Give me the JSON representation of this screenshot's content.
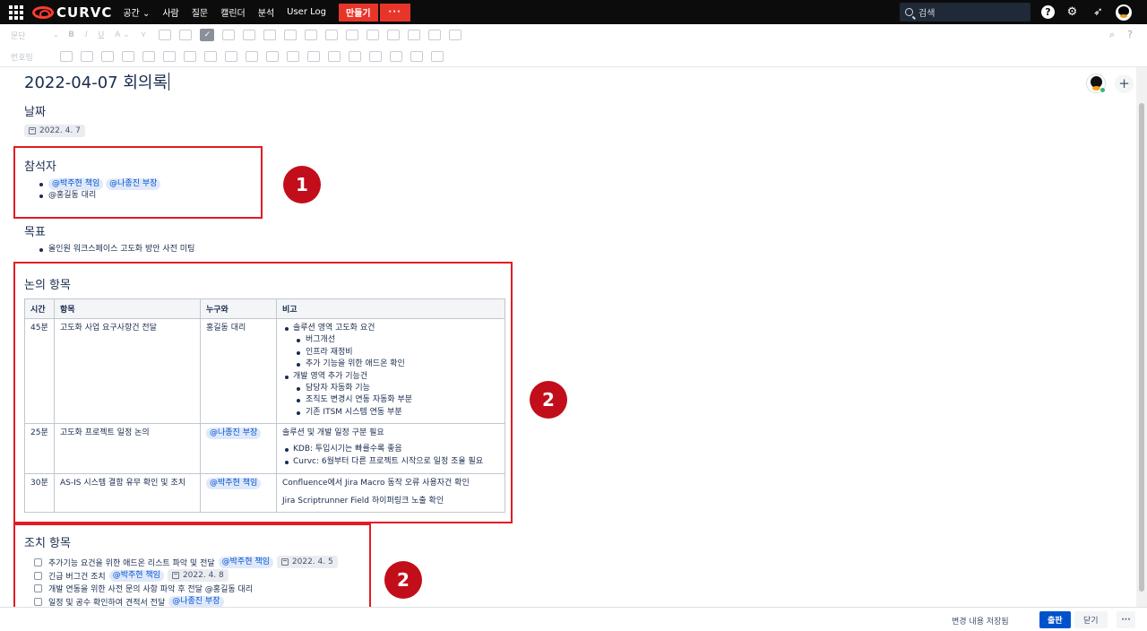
{
  "topbar": {
    "logo": "CURVC",
    "nav": [
      "공간 ⌄",
      "사람",
      "질문",
      "캘린더",
      "분석",
      "User Log"
    ],
    "create_label": "만들기",
    "more_label": "···",
    "search_placeholder": "검색"
  },
  "toolbar": {
    "style_select": "문단",
    "row2_label": "번호링"
  },
  "page": {
    "title": "2022-04-07 회의록",
    "date_heading": "날짜",
    "date_value": "2022. 4. 7",
    "attendees_heading": "참석자",
    "attendees": {
      "mention1": "@박주현 책임",
      "mention2": "@나종진 부장",
      "plain": "@홍길동 대리"
    },
    "goal_heading": "목표",
    "goals": [
      "올인원 워크스페이스 고도화 방안 사전 미팅"
    ],
    "discussion_heading": "논의 항목",
    "table": {
      "headers": [
        "시간",
        "항목",
        "누구와",
        "비고"
      ],
      "rows": [
        {
          "time": "45분",
          "item": "고도화 사업 요구사항건 전달",
          "who": "홍길동 대리"
        },
        {
          "time": "25분",
          "item": "고도화 프로젝트 일정 논의",
          "who": "@나종진 부장"
        },
        {
          "time": "30분",
          "item": "AS-IS 시스템 결함 유무 확인 및 조치",
          "who": "@박주현 책임"
        }
      ],
      "row1_notes": {
        "a": "솔루션 영역 고도화 요건",
        "a_sub": [
          "버그개선",
          "인프라 재정비",
          "추가 기능을 위한 애드온 확인"
        ],
        "b": "개발 영역 추가 기능건",
        "b_sub": [
          "담당자 자동화 기능",
          "조직도 변경시 연동 자동화 부분",
          "기존 ITSM 시스템 연동 부분"
        ]
      },
      "row2_notes": {
        "line": "솔루션 및 개발 일정 구분 필요",
        "items": [
          "KDB: 투입시기는 빠를수록 좋음",
          "Curvc: 6월부터 다른 프로젝트 시작으로 일정 조율 필요"
        ]
      },
      "row3_notes": {
        "line1": "Confluence에서 Jira Macro 동작 오류 사용자건 확인",
        "line2": "Jira Scriptrunner Field 하이퍼링크 노출 확인"
      }
    },
    "actions_heading": "조치 항목",
    "tasks": {
      "t1_text": "추가기능 요건을 위한 애드온 리스트 파악 및 전달",
      "t1_mention": "@박주현 책임",
      "t1_date": "2022. 4. 5",
      "t2_text": "긴급 버그건 조치",
      "t2_mention": "@박주현 책임",
      "t2_date": "2022. 4. 8",
      "t3_text": "개발 연동을 위한 사전 문의 사항 파악 후 전달 @홍길동 대리",
      "t4_text": "일정 및 공수 확인하여 견적서 전달",
      "t4_mention": "@나종진 부장"
    }
  },
  "annotations": {
    "badge1": "1",
    "badge2": "2",
    "badge3": "2",
    "color": "#c20e1a"
  },
  "footer": {
    "saved_status": "변경 내용 저장됨",
    "publish_label": "출판",
    "close_label": "닫기",
    "more_label": "···"
  },
  "icons": [
    "apps-grid-icon",
    "search-icon",
    "help-icon",
    "settings-icon",
    "rocket-icon",
    "avatar",
    "calendar-icon",
    "plus-icon"
  ]
}
